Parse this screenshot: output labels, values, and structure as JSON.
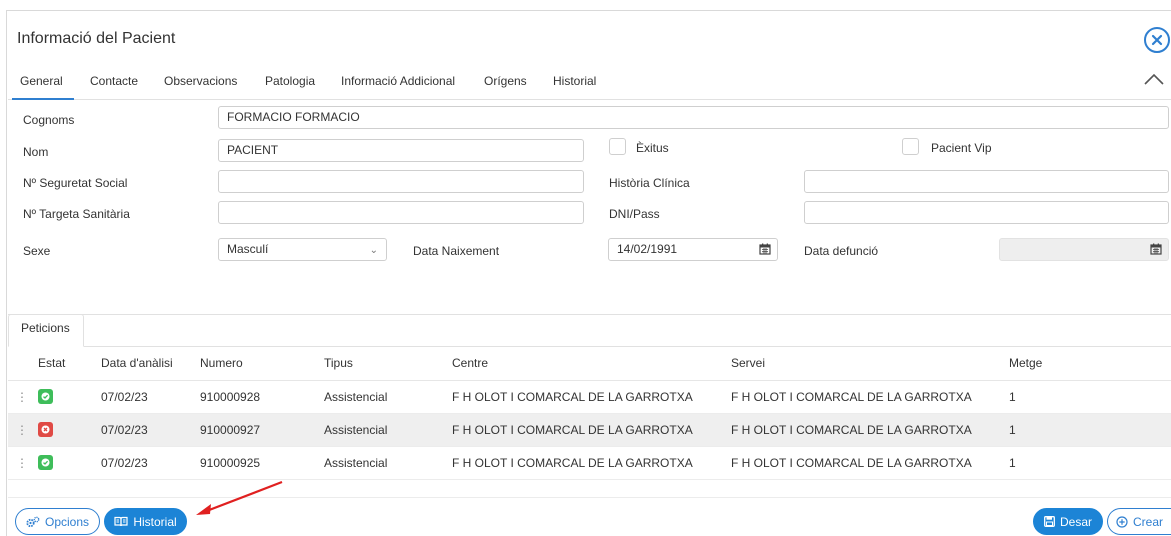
{
  "dialog": {
    "title": "Informació del Pacient"
  },
  "tabs": [
    {
      "label": "General",
      "active": true
    },
    {
      "label": "Contacte"
    },
    {
      "label": "Observacions"
    },
    {
      "label": "Patologia"
    },
    {
      "label": "Informació Addicional"
    },
    {
      "label": "Orígens"
    },
    {
      "label": "Historial"
    }
  ],
  "form": {
    "cognoms_label": "Cognoms",
    "cognoms_value": "FORMACIO FORMACIO",
    "nom_label": "Nom",
    "nom_value": "PACIENT",
    "exitus_label": "Èxitus",
    "pacient_vip_label": "Pacient Vip",
    "seguretat_social_label": "Nº Seguretat Social",
    "seguretat_social_value": "",
    "historia_clinica_label": "Història Clínica",
    "historia_clinica_value": "",
    "targeta_sanitaria_label": "Nº Targeta Sanitària",
    "targeta_sanitaria_value": "",
    "dni_label": "DNI/Pass",
    "dni_value": "",
    "sexe_label": "Sexe",
    "sexe_value": "Masculí",
    "data_naixement_label": "Data Naixement",
    "data_naixement_value": "14/02/1991",
    "data_defuncio_label": "Data defunció",
    "data_defuncio_value": ""
  },
  "peticions": {
    "tab_label": "Peticions",
    "columns": [
      "Estat",
      "Data d'anàlisi",
      "Numero",
      "Tipus",
      "Centre",
      "Servei",
      "Metge"
    ],
    "rows": [
      {
        "status": "ok",
        "data": "07/02/23",
        "numero": "910000928",
        "tipus": "Assistencial",
        "centre": "F H OLOT I COMARCAL DE LA GARROTXA",
        "servei": "F H OLOT I COMARCAL DE LA GARROTXA",
        "metge": "1"
      },
      {
        "status": "error",
        "data": "07/02/23",
        "numero": "910000927",
        "tipus": "Assistencial",
        "centre": "F H OLOT I COMARCAL DE LA GARROTXA",
        "servei": "F H OLOT I COMARCAL DE LA GARROTXA",
        "metge": "1"
      },
      {
        "status": "ok",
        "data": "07/02/23",
        "numero": "910000925",
        "tipus": "Assistencial",
        "centre": "F H OLOT I COMARCAL DE LA GARROTXA",
        "servei": "F H OLOT I COMARCAL DE LA GARROTXA",
        "metge": "1"
      }
    ]
  },
  "footer": {
    "opcions_label": "Opcions",
    "historial_label": "Historial",
    "desar_label": "Desar",
    "crear_label": "Crear"
  },
  "colors": {
    "accent": "#1c84d6",
    "status_ok": "#3ebd5a",
    "status_error": "#e04a45",
    "annotation_arrow": "#e02020"
  }
}
